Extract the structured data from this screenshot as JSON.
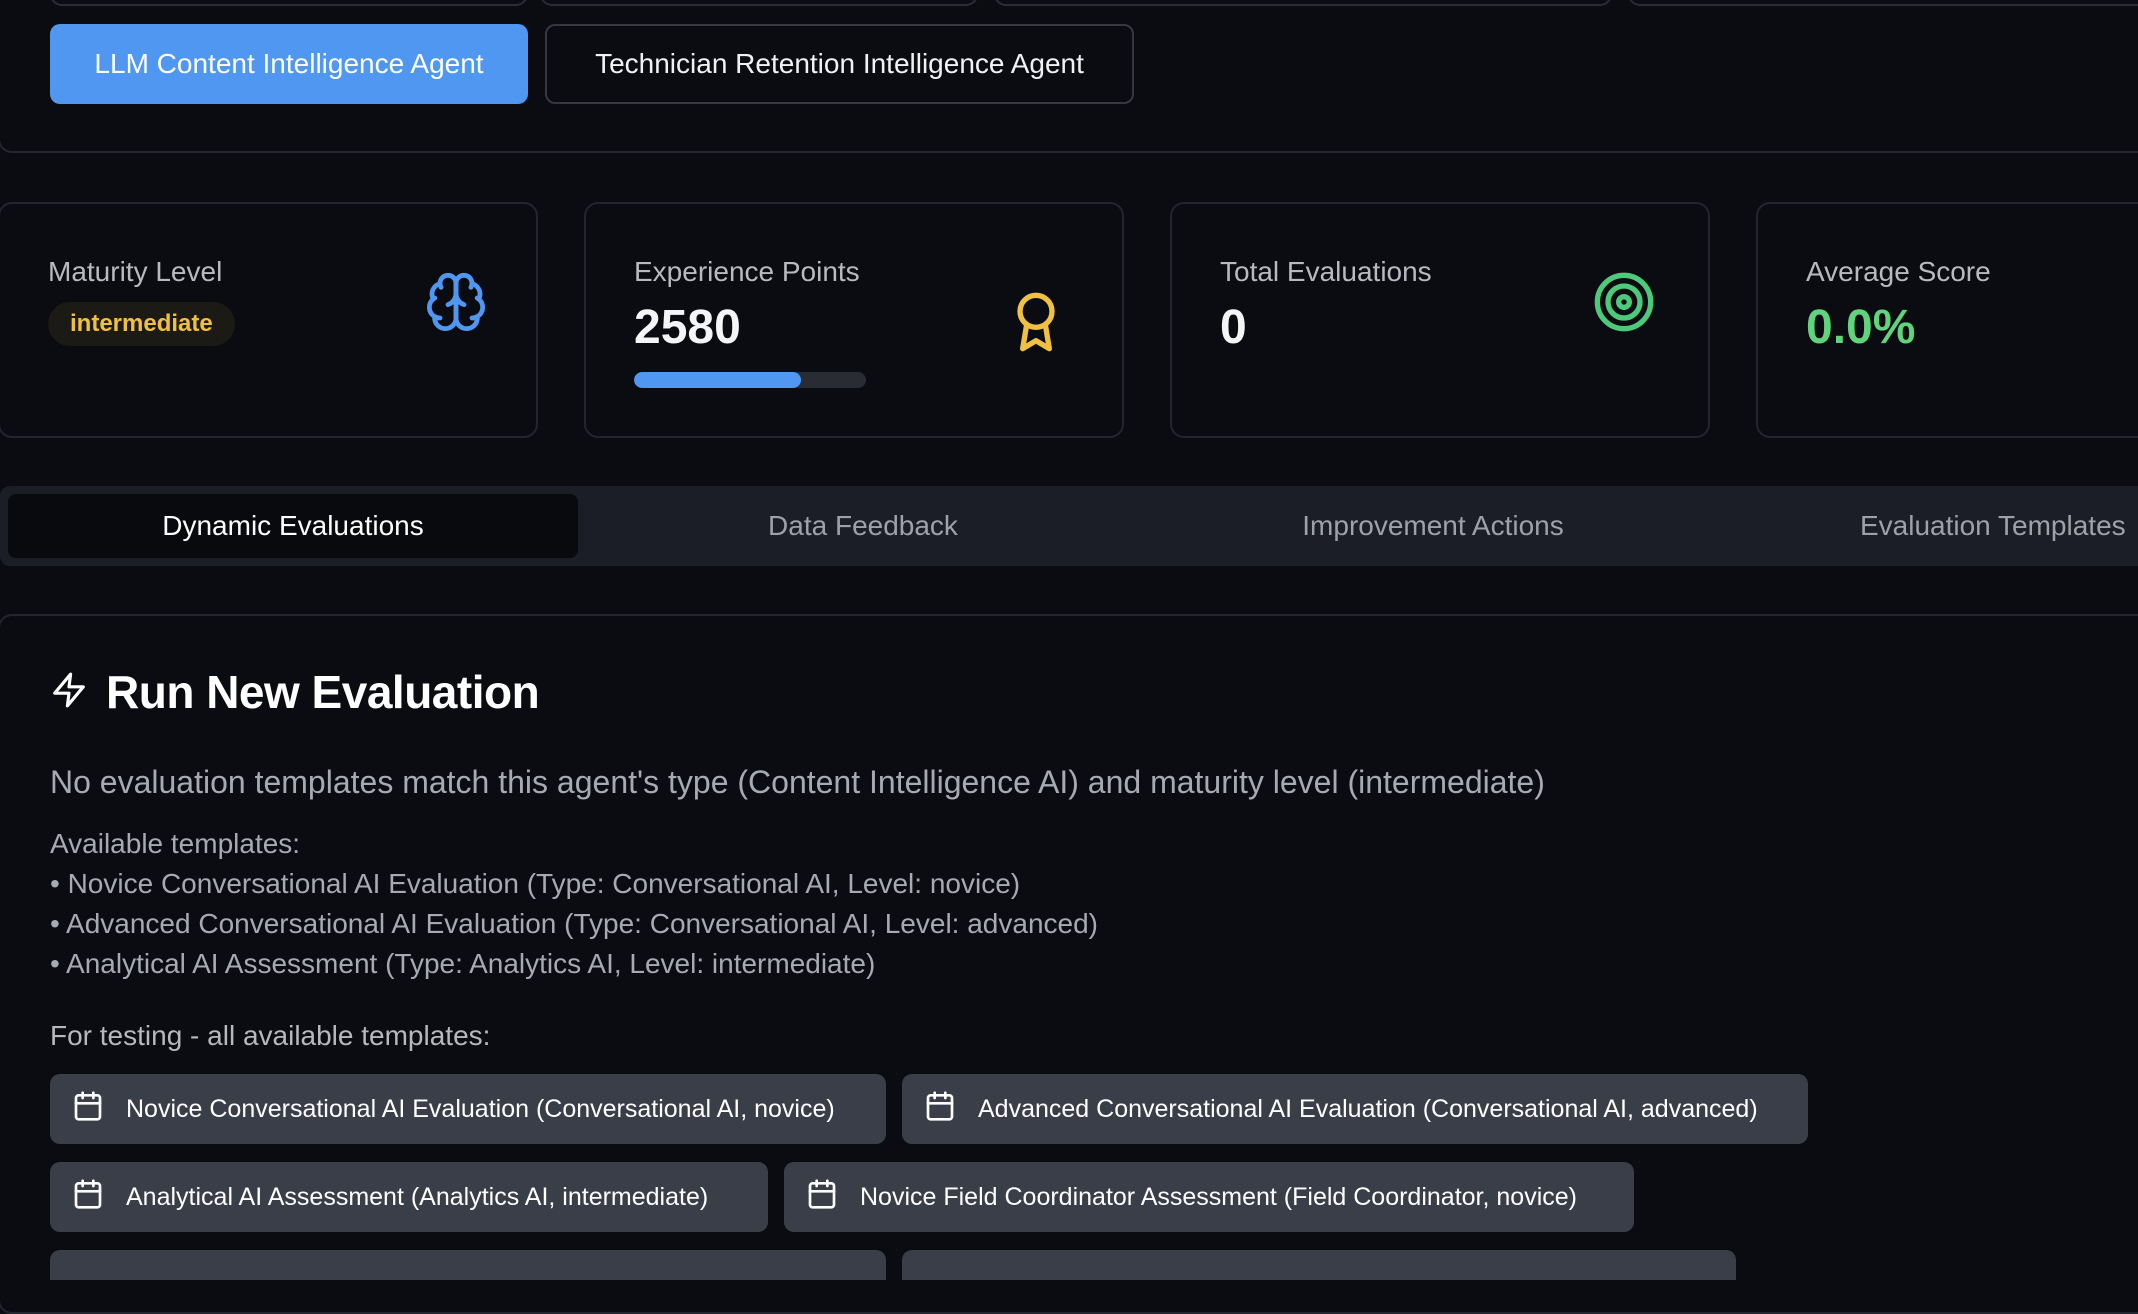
{
  "agents": {
    "active": "LLM Content Intelligence Agent",
    "other": "Technician Retention Intelligence Agent"
  },
  "stats": {
    "maturity": {
      "label": "Maturity Level",
      "value": "intermediate"
    },
    "xp": {
      "label": "Experience Points",
      "value": "2580",
      "progress": 0.72
    },
    "evals": {
      "label": "Total Evaluations",
      "value": "0"
    },
    "score": {
      "label": "Average Score",
      "value": "0.0%"
    }
  },
  "tabs": [
    "Dynamic Evaluations",
    "Data Feedback",
    "Improvement Actions",
    "Evaluation Templates"
  ],
  "evaluation": {
    "title": "Run New Evaluation",
    "notice": "No evaluation templates match this agent's type (Content Intelligence AI) and maturity level (intermediate)",
    "available_title": "Available templates:",
    "available": [
      "• Novice Conversational AI Evaluation (Type: Conversational AI, Level: novice)",
      "• Advanced Conversational AI Evaluation (Type: Conversational AI, Level: advanced)",
      "• Analytical AI Assessment (Type: Analytics AI, Level: intermediate)"
    ],
    "testing_title": "For testing - all available templates:",
    "template_buttons": [
      "Novice Conversational AI Evaluation (Conversational AI, novice)",
      "Advanced Conversational AI Evaluation (Conversational AI, advanced)",
      "Analytical AI Assessment (Analytics AI, intermediate)",
      "Novice Field Coordinator Assessment (Field Coordinator, novice)"
    ]
  },
  "colors": {
    "accent": "#4f97f1",
    "maturity_badge": "#f0c040",
    "award_icon": "#f0c040",
    "target_icon": "#4cc97a",
    "score": "#5fd47d"
  },
  "icons": [
    "brain-icon",
    "award-icon",
    "target-icon",
    "zap-icon",
    "calendar-icon"
  ]
}
